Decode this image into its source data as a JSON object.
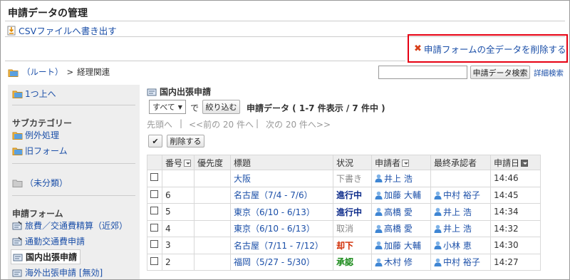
{
  "page": {
    "title": "申請データの管理"
  },
  "actions": {
    "csv_export": "CSVファイルへ書き出す",
    "delete_all": "申請フォームの全データを削除する"
  },
  "breadcrumb": {
    "root": "（ルート）",
    "separator": ">",
    "current": "経理関連"
  },
  "search": {
    "button": "申請データ検索",
    "advanced": "詳細検索"
  },
  "sidebar": {
    "up": "1つ上へ",
    "subcategory_heading": "サブカテゴリー",
    "subcategories": [
      "例外処理",
      "旧フォーム"
    ],
    "uncategorized": "（未分類）",
    "forms_heading": "申請フォーム",
    "forms": [
      "旅費／交通費精算（近郊）",
      "通勤交通費申請",
      "国内出張申請",
      "海外出張申請 [無効]"
    ],
    "selected_form": "国内出張申請"
  },
  "main": {
    "form_title": "国内出張申請",
    "filter": {
      "selected": "すべて",
      "label": "で",
      "button": "絞り込む"
    },
    "count_text": "申請データ ( 1-7 件表示 / 7 件中 )",
    "pager": {
      "first": "先頭へ",
      "sep1": "|",
      "prev": "<<前の 20 件へ",
      "sep2": "|",
      "next": "次の 20 件へ>>"
    },
    "delete_button": "削除する",
    "columns": {
      "number": "番号",
      "priority": "優先度",
      "subject": "標題",
      "status": "状況",
      "applicant": "申請者",
      "approver": "最終承認者",
      "date": "申請日"
    },
    "rows": [
      {
        "number": "",
        "priority": "",
        "subject": "大阪",
        "status": "下書き",
        "applicant": "井上 浩",
        "approver": "",
        "date": "14:46"
      },
      {
        "number": "6",
        "priority": "",
        "subject": "名古屋（7/4 - 7/6）",
        "status": "進行中",
        "applicant": "加藤 大輔",
        "approver": "中村 裕子",
        "date": "14:45"
      },
      {
        "number": "5",
        "priority": "",
        "subject": "東京（6/10 - 6/13）",
        "status": "進行中",
        "applicant": "高橋 愛",
        "approver": "井上 浩",
        "date": "14:34"
      },
      {
        "number": "4",
        "priority": "",
        "subject": "東京（6/10 - 6/13）",
        "status": "取消",
        "applicant": "高橋 愛",
        "approver": "井上 浩",
        "date": "14:32"
      },
      {
        "number": "3",
        "priority": "",
        "subject": "名古屋（7/11 - 7/12）",
        "status": "却下",
        "applicant": "加藤 大輔",
        "approver": "小林 恵",
        "date": "14:30"
      },
      {
        "number": "2",
        "priority": "",
        "subject": "福岡（5/27 - 5/30）",
        "status": "承認",
        "applicant": "木村 修",
        "approver": "中村 裕子",
        "date": "14:27"
      }
    ]
  },
  "colors": {
    "link": "#1b4fa8",
    "highlight": "#e60012",
    "status_progress": "#0b2a8a",
    "status_rejected": "#d02a00",
    "status_approved": "#1a8a1a",
    "status_muted": "#888888"
  }
}
